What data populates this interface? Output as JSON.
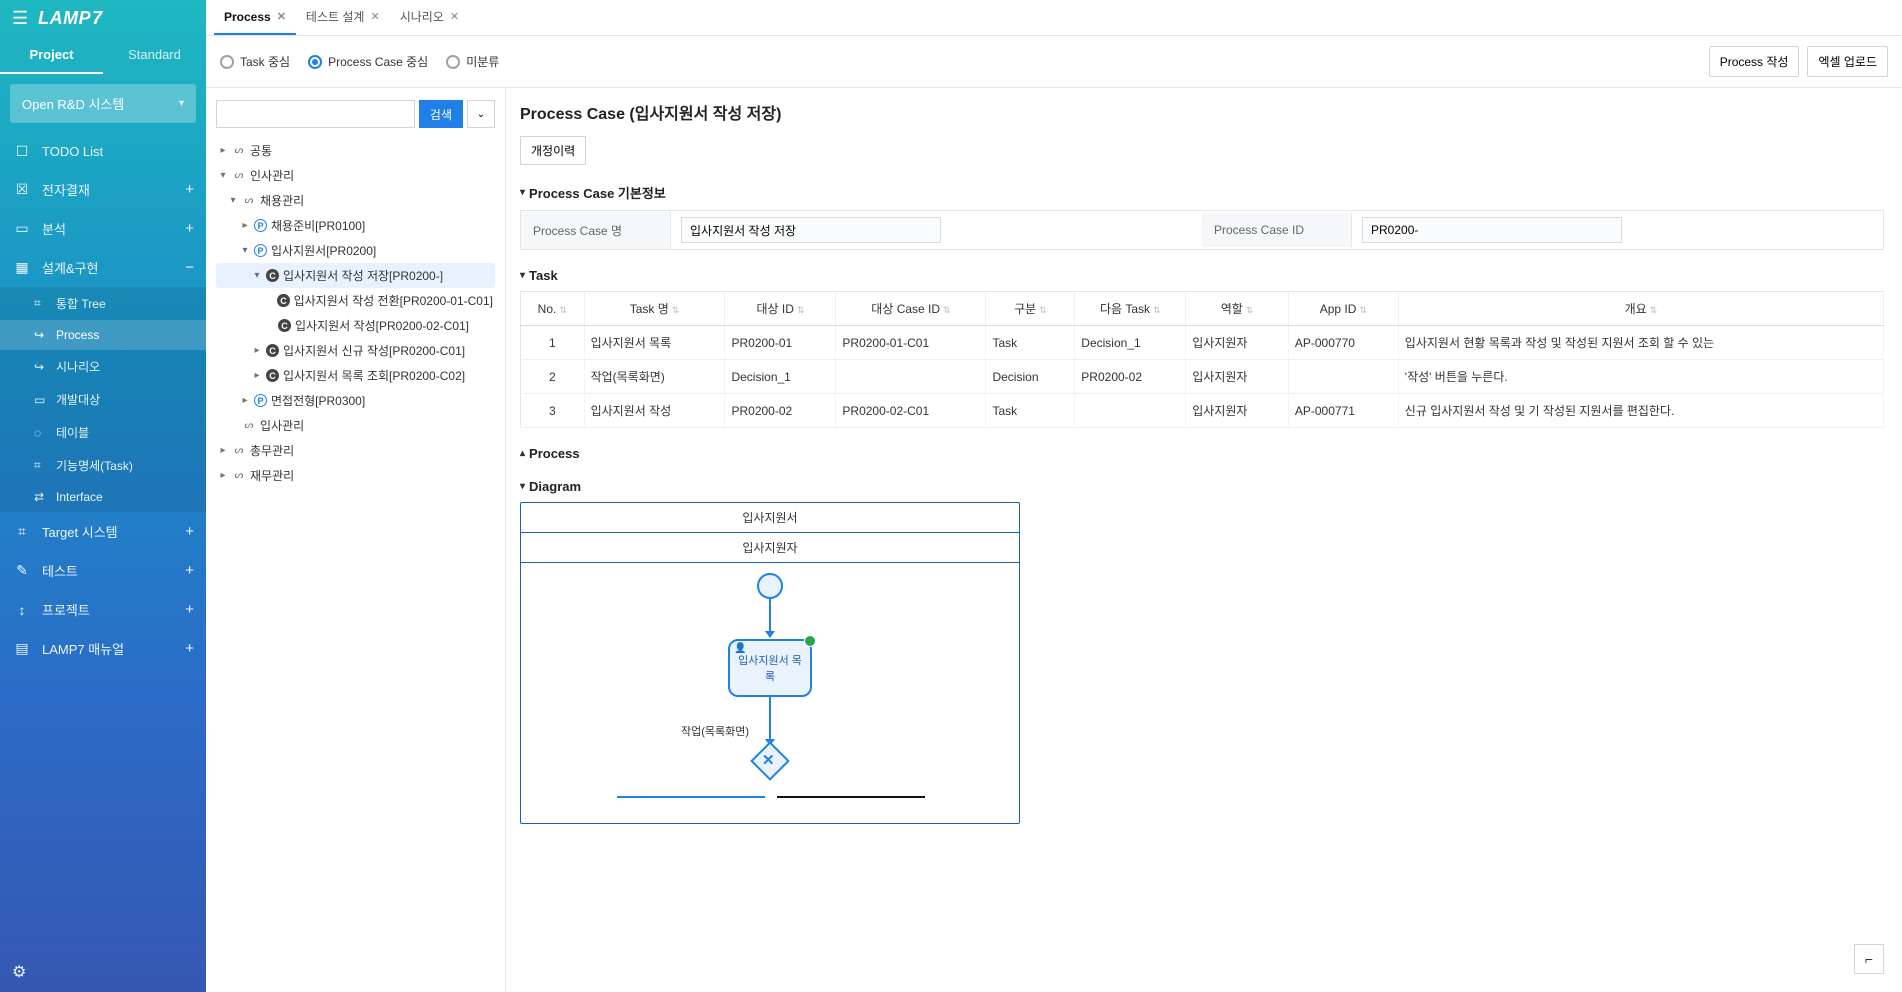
{
  "logo": {
    "text": "LAMP",
    "suffix": "7"
  },
  "sidebar": {
    "tabs": [
      "Project",
      "Standard"
    ],
    "active_tab": 0,
    "project_selector": "Open R&D 시스템",
    "menu": [
      {
        "icon": "☐",
        "label": "TODO List",
        "trail": ""
      },
      {
        "icon": "☒",
        "label": "전자결재",
        "trail": "+"
      },
      {
        "icon": "▭",
        "label": "분석",
        "trail": "+"
      },
      {
        "icon": "▦",
        "label": "설계&구현",
        "trail": "−",
        "open": true,
        "children": [
          {
            "icon": "⌗",
            "label": "통합 Tree"
          },
          {
            "icon": "↪",
            "label": "Process",
            "active": true
          },
          {
            "icon": "↪",
            "label": "시나리오"
          },
          {
            "icon": "▭",
            "label": "개발대상"
          },
          {
            "icon": "◌",
            "label": "테이블"
          },
          {
            "icon": "⌗",
            "label": "기능명세(Task)"
          },
          {
            "icon": "⇄",
            "label": "Interface"
          }
        ]
      },
      {
        "icon": "⌗",
        "label": "Target 시스템",
        "trail": "+"
      },
      {
        "icon": "✎",
        "label": "테스트",
        "trail": "+"
      },
      {
        "icon": "↕",
        "label": "프로젝트",
        "trail": "+"
      },
      {
        "icon": "▤",
        "label": "LAMP7 매뉴얼",
        "trail": "+"
      }
    ]
  },
  "tabs": [
    {
      "label": "Process",
      "active": true
    },
    {
      "label": "테스트 설계"
    },
    {
      "label": "시나리오"
    }
  ],
  "view_mode": {
    "options": [
      "Task 중심",
      "Process Case 중심",
      "미분류"
    ],
    "selected": 1
  },
  "buttons": {
    "process_create": "Process 작성",
    "excel_upload": "엑셀 업로드",
    "search": "검색",
    "history": "개정이력"
  },
  "tree": [
    {
      "toggle": "▸",
      "kind": "folder",
      "label": "공통",
      "depth": 0
    },
    {
      "toggle": "▾",
      "kind": "folder",
      "label": "인사관리",
      "depth": 0
    },
    {
      "toggle": "▾",
      "kind": "folder",
      "label": "채용관리",
      "depth": 1
    },
    {
      "toggle": "▸",
      "kind": "p",
      "label": "채용준비[PR0100]",
      "depth": 2
    },
    {
      "toggle": "▾",
      "kind": "p",
      "label": "입사지원서[PR0200]",
      "depth": 2
    },
    {
      "toggle": "▾",
      "kind": "c",
      "label": "입사지원서 작성 저장[PR0200-]",
      "depth": 3,
      "selected": true
    },
    {
      "toggle": "",
      "kind": "c",
      "label": "입사지원서 작성 전환[PR0200-01-C01]",
      "depth": 4
    },
    {
      "toggle": "",
      "kind": "c",
      "label": "입사지원서 작성[PR0200-02-C01]",
      "depth": 4
    },
    {
      "toggle": "▸",
      "kind": "c",
      "label": "입사지원서 신규 작성[PR0200-C01]",
      "depth": 3
    },
    {
      "toggle": "▸",
      "kind": "c",
      "label": "입사지원서 목록 조회[PR0200-C02]",
      "depth": 3
    },
    {
      "toggle": "▸",
      "kind": "p",
      "label": "면접전형[PR0300]",
      "depth": 2
    },
    {
      "toggle": "",
      "kind": "folder",
      "label": "입사관리",
      "depth": 1
    },
    {
      "toggle": "▸",
      "kind": "folder",
      "label": "총무관리",
      "depth": 0
    },
    {
      "toggle": "▸",
      "kind": "folder",
      "label": "재무관리",
      "depth": 0
    }
  ],
  "page_title": "Process Case (입사지원서 작성 저장)",
  "sections": {
    "basic": {
      "title": "Process Case 기본정보",
      "name_label": "Process Case 명",
      "name_value": "입사지원서 작성 저장",
      "id_label": "Process Case ID",
      "id_value": "PR0200-"
    },
    "task": {
      "title": "Task",
      "cols": [
        "No.",
        "Task 명",
        "대상 ID",
        "대상 Case ID",
        "구분",
        "다음 Task",
        "역할",
        "App ID",
        "개요"
      ],
      "rows": [
        [
          "1",
          "입사지원서 목록",
          "PR0200-01",
          "PR0200-01-C01",
          "Task",
          "Decision_1",
          "입사지원자",
          "AP-000770",
          "입사지원서 현황 목록과 작성 및 작성된 지원서 조회 할 수 있는"
        ],
        [
          "2",
          "작업(목록화면)",
          "Decision_1",
          "",
          "Decision",
          "PR0200-02",
          "입사지원자",
          "",
          "'작성' 버튼을 누른다."
        ],
        [
          "3",
          "입사지원서 작성",
          "PR0200-02",
          "PR0200-02-C01",
          "Task",
          "",
          "입사지원자",
          "AP-000771",
          "신규 입사지원서 작성 및 기 작성된 지원서를 편집한다."
        ]
      ]
    },
    "process": {
      "title": "Process"
    },
    "diagram": {
      "title": "Diagram",
      "lane_title": "입사지원서",
      "lane_sub": "입사지원자",
      "task_label": "입사지원서 목록",
      "decision_label": "작업(목록화면)"
    }
  }
}
